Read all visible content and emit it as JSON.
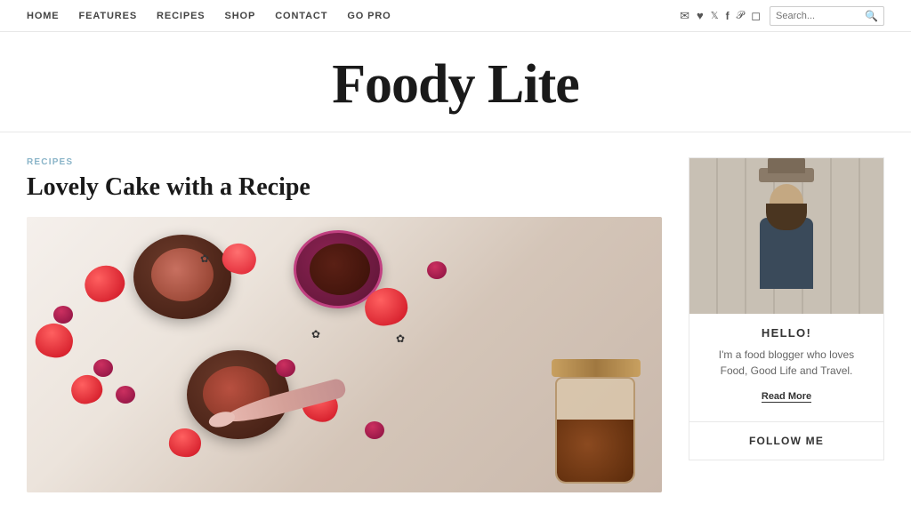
{
  "nav": {
    "links": [
      {
        "label": "HOME",
        "id": "home"
      },
      {
        "label": "FEATURES",
        "id": "features"
      },
      {
        "label": "RECIPES",
        "id": "recipes"
      },
      {
        "label": "SHOP",
        "id": "shop"
      },
      {
        "label": "CONTACT",
        "id": "contact"
      },
      {
        "label": "GO PRO",
        "id": "gopro"
      }
    ],
    "icons": [
      {
        "name": "email-icon",
        "symbol": "✉"
      },
      {
        "name": "heart-icon",
        "symbol": "♥"
      },
      {
        "name": "twitter-icon",
        "symbol": "𝕏"
      },
      {
        "name": "facebook-icon",
        "symbol": "f"
      },
      {
        "name": "pinterest-icon",
        "symbol": "𝒫"
      },
      {
        "name": "instagram-icon",
        "symbol": "◻"
      }
    ],
    "search_placeholder": "Search..."
  },
  "site": {
    "title": "Foody Lite"
  },
  "post": {
    "category": "RECIPES",
    "title": "Lovely Cake with a Recipe",
    "image_alt": "Chocolate dessert bowls with strawberries and raspberries"
  },
  "sidebar": {
    "hello_label": "HELLO!",
    "bio": "I'm a food blogger who loves Food, Good Life and Travel.",
    "read_more_label": "Read More",
    "follow_label": "FOLLOW ME"
  }
}
